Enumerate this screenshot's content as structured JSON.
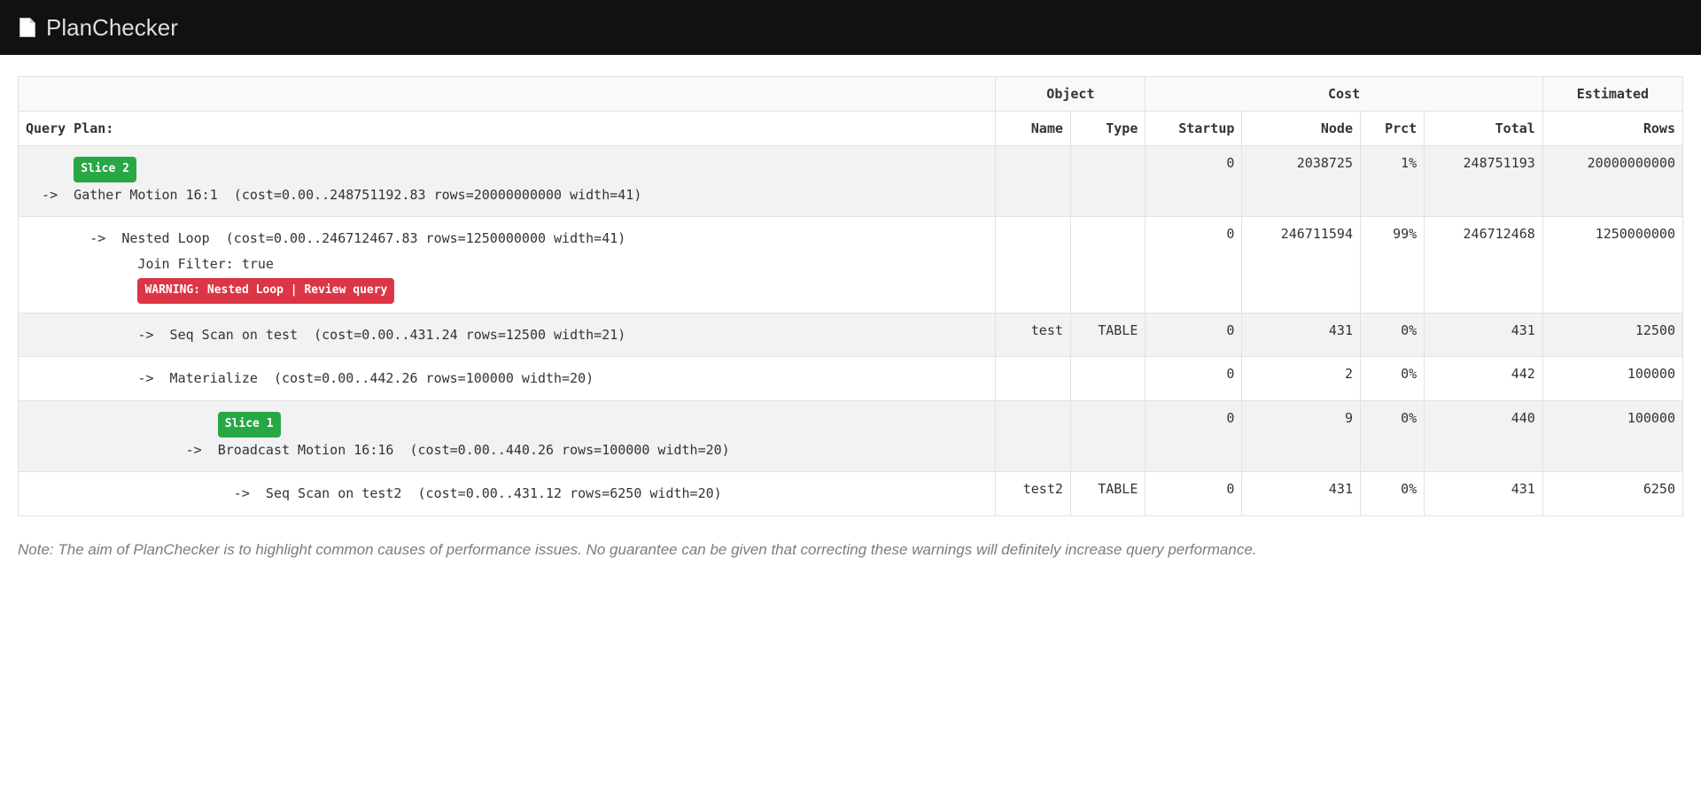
{
  "header": {
    "brand": "PlanChecker"
  },
  "table": {
    "top_headers": {
      "plan": "",
      "object": "Object",
      "cost": "Cost",
      "estimated": "Estimated"
    },
    "sub_headers": {
      "plan": "Query Plan:",
      "name": "Name",
      "type": "Type",
      "startup": "Startup",
      "node": "Node",
      "prct": "Prct",
      "total": "Total",
      "rows": "Rows"
    },
    "rows": [
      {
        "striped": true,
        "indent": "      ",
        "slice_badge": "Slice 2",
        "line1": "  ->  Gather Motion 16:1  (cost=0.00..248751192.83 rows=20000000000 width=41)",
        "extra": null,
        "warning": null,
        "name": "",
        "type": "",
        "startup": "0",
        "node": "2038725",
        "prct": "1%",
        "total": "248751193",
        "rows": "20000000000"
      },
      {
        "striped": false,
        "indent": "        ",
        "slice_badge": null,
        "line1": "        ->  Nested Loop  (cost=0.00..246712467.83 rows=1250000000 width=41)",
        "extra": "              Join Filter: true",
        "warning": "WARNING: Nested Loop | Review query",
        "warning_indent": "              ",
        "name": "",
        "type": "",
        "startup": "0",
        "node": "246711594",
        "prct": "99%",
        "total": "246712468",
        "rows": "1250000000"
      },
      {
        "striped": true,
        "indent": "              ",
        "slice_badge": null,
        "line1": "              ->  Seq Scan on test  (cost=0.00..431.24 rows=12500 width=21)",
        "extra": null,
        "warning": null,
        "name": "test",
        "type": "TABLE",
        "startup": "0",
        "node": "431",
        "prct": "0%",
        "total": "431",
        "rows": "12500"
      },
      {
        "striped": false,
        "indent": "              ",
        "slice_badge": null,
        "line1": "              ->  Materialize  (cost=0.00..442.26 rows=100000 width=20)",
        "extra": null,
        "warning": null,
        "name": "",
        "type": "",
        "startup": "0",
        "node": "2",
        "prct": "0%",
        "total": "442",
        "rows": "100000"
      },
      {
        "striped": true,
        "indent": "                        ",
        "slice_badge": "Slice 1",
        "line1": "                    ->  Broadcast Motion 16:16  (cost=0.00..440.26 rows=100000 width=20)",
        "extra": null,
        "warning": null,
        "name": "",
        "type": "",
        "startup": "0",
        "node": "9",
        "prct": "0%",
        "total": "440",
        "rows": "100000"
      },
      {
        "striped": false,
        "indent": "                          ",
        "slice_badge": null,
        "line1": "                          ->  Seq Scan on test2  (cost=0.00..431.12 rows=6250 width=20)",
        "extra": null,
        "warning": null,
        "name": "test2",
        "type": "TABLE",
        "startup": "0",
        "node": "431",
        "prct": "0%",
        "total": "431",
        "rows": "6250"
      }
    ]
  },
  "footnote": "Note: The aim of PlanChecker is to highlight common causes of performance issues. No guarantee can be given that correcting these warnings will definitely increase query performance."
}
